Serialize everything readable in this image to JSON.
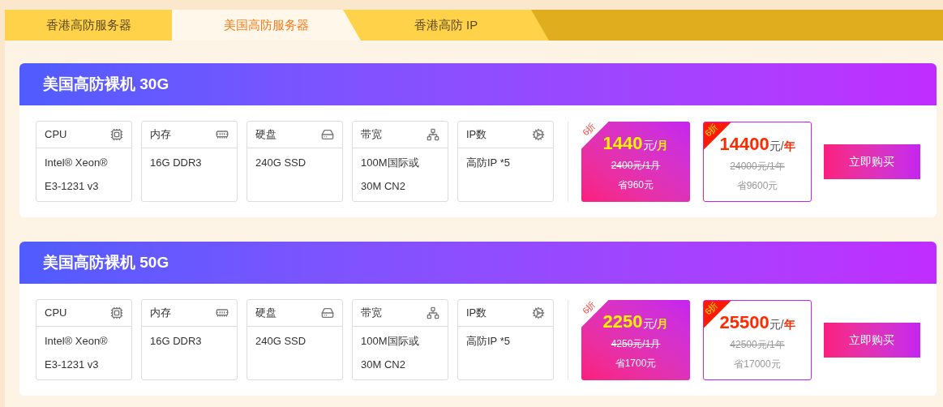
{
  "tabs": [
    {
      "label": "香港高防服务器",
      "selected": false
    },
    {
      "label": "美国高防服务器",
      "selected": true
    },
    {
      "label": "香港高防 IP",
      "selected": false
    }
  ],
  "products": [
    {
      "title": "美国高防裸机 30G",
      "specs": [
        {
          "label": "CPU",
          "lines": [
            "Intel® Xeon®",
            "E3-1231 v3"
          ]
        },
        {
          "label": "内存",
          "lines": [
            "16G DDR3"
          ]
        },
        {
          "label": "硬盘",
          "lines": [
            "240G SSD"
          ]
        },
        {
          "label": "带宽",
          "lines": [
            "100M国际或",
            "30M CN2"
          ]
        },
        {
          "label": "IP数",
          "lines": [
            "高防IP *5"
          ]
        }
      ],
      "prices": [
        {
          "kind": "monthly",
          "badge": "6折",
          "amount": "1440",
          "unit": "元/",
          "period": "月",
          "original": "2400元/1月",
          "saving": "省960元"
        },
        {
          "kind": "yearly",
          "badge": "6折",
          "amount": "14400",
          "unit": "元/",
          "period": "年",
          "original": "24000元/1年",
          "saving": "省9600元"
        }
      ],
      "button": "立即购买"
    },
    {
      "title": "美国高防裸机 50G",
      "specs": [
        {
          "label": "CPU",
          "lines": [
            "Intel® Xeon®",
            "E3-1231 v3"
          ]
        },
        {
          "label": "内存",
          "lines": [
            "16G DDR3"
          ]
        },
        {
          "label": "硬盘",
          "lines": [
            "240G SSD"
          ]
        },
        {
          "label": "带宽",
          "lines": [
            "100M国际或",
            "30M CN2"
          ]
        },
        {
          "label": "IP数",
          "lines": [
            "高防IP *5"
          ]
        }
      ],
      "prices": [
        {
          "kind": "monthly",
          "badge": "6折",
          "amount": "2250",
          "unit": "元/",
          "period": "月",
          "original": "4250元/1月",
          "saving": "省1700元"
        },
        {
          "kind": "yearly",
          "badge": "6折",
          "amount": "25500",
          "unit": "元/",
          "period": "年",
          "original": "42500元/1年",
          "saving": "省17000元"
        }
      ],
      "button": "立即购买"
    }
  ]
}
